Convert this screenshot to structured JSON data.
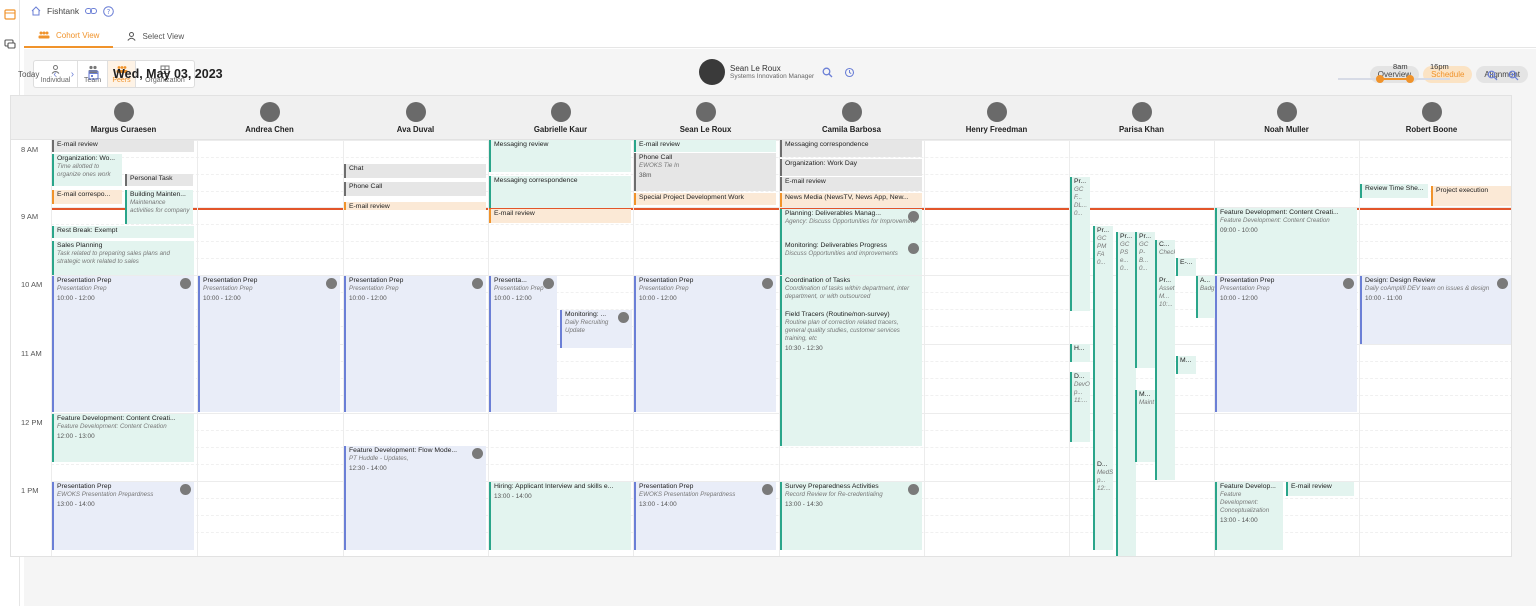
{
  "topbar": {
    "app_name": "Fishtank"
  },
  "tabs": [
    {
      "label": "Cohort View"
    },
    {
      "label": "Select View"
    }
  ],
  "levels": [
    {
      "label": "Individual"
    },
    {
      "label": "Team"
    },
    {
      "label": "Peers"
    },
    {
      "label": "Organization"
    }
  ],
  "current_user": {
    "name": "Sean Le Roux",
    "role": "Systems Innovation Manager"
  },
  "modes": [
    {
      "label": "Overview"
    },
    {
      "label": "Schedule"
    },
    {
      "label": "Alignment"
    }
  ],
  "date_nav": {
    "today": "Today",
    "date": "Wed, May 03, 2023"
  },
  "range": {
    "start_label": "8am",
    "end_label": "16pm",
    "start_fraction": 0.375,
    "end_fraction": 0.64
  },
  "colors": {
    "accent": "#f0932b",
    "now_line": "#e2552a",
    "teal": "#2aa58a",
    "blue": "#6b7fd6"
  },
  "columns": [
    {
      "name": "Margus Curaesen"
    },
    {
      "name": "Andrea Chen"
    },
    {
      "name": "Ava Duval"
    },
    {
      "name": "Gabrielle Kaur"
    },
    {
      "name": "Sean Le Roux"
    },
    {
      "name": "Camila Barbosa"
    },
    {
      "name": "Henry Freedman"
    },
    {
      "name": "Parisa Khan"
    },
    {
      "name": "Noah Muller"
    },
    {
      "name": "Robert Boone"
    }
  ],
  "time_labels": [
    "8 AM",
    "9 AM",
    "10 AM",
    "11 AM",
    "12 PM",
    "1 PM"
  ],
  "events": {
    "m1": {
      "title": "E-mail review"
    },
    "m2": {
      "title": "Organization: Wo...",
      "desc": "Time allotted to organize ones work"
    },
    "m3": {
      "title": "Personal Task"
    },
    "m4": {
      "title": "E-mail correspo..."
    },
    "m5": {
      "title": "Building Mainten...",
      "desc": "Maintenance activities for company"
    },
    "m6": {
      "title": "Rest Break: Exempt"
    },
    "m7": {
      "title": "Sales Planning",
      "desc": "Task related to preparing sales plans and strategic work related to sales"
    },
    "m8": {
      "title": "Presentation Prep",
      "desc": "Presentation Prep",
      "time": "10:00 - 12:00"
    },
    "m9": {
      "title": "Feature Development: Content Creati...",
      "desc": "Feature Development: Content Creation",
      "time": "12:00 - 13:00"
    },
    "m10": {
      "title": "Presentation Prep",
      "desc": "EWOKS Presentation Prepardness",
      "time": "13:00 - 14:00"
    },
    "a1": {
      "title": "Presentation Prep",
      "desc": "Presentation Prep",
      "time": "10:00 - 12:00"
    },
    "v1": {
      "title": "Chat"
    },
    "v2": {
      "title": "Phone Call"
    },
    "v3": {
      "title": "E-mail review"
    },
    "v4": {
      "title": "Presentation Prep",
      "desc": "Presentation Prep",
      "time": "10:00 - 12:00"
    },
    "v5": {
      "title": "Feature Development: Flow Mode...",
      "desc": "PT Huddle - Updates,",
      "time": "12:30 - 14:00"
    },
    "g1": {
      "title": "Messaging review"
    },
    "g2": {
      "title": "Messaging correspondence"
    },
    "g3": {
      "title": "E-mail review"
    },
    "g4": {
      "title": "Presenta...",
      "desc": "Presentation Prep",
      "time": "10:00 - 12:00"
    },
    "g5": {
      "title": "Monitoring: ...",
      "desc": "Daily Recruiting Update"
    },
    "g6": {
      "title": "Hiring: Applicant Interview and skills e...",
      "time": "13:00 - 14:00"
    },
    "s1": {
      "title": "E-mail review"
    },
    "s2": {
      "title": "Phone Call",
      "desc": "EWOKS Tie In",
      "time": "38m"
    },
    "s3": {
      "title": "Special Project Development Work"
    },
    "s4": {
      "title": "Presentation Prep",
      "desc": "Presentation Prep",
      "time": "10:00 - 12:00"
    },
    "s5": {
      "title": "Presentation Prep",
      "desc": "EWOKS Presentation Prepardness",
      "time": "13:00 - 14:00"
    },
    "c1": {
      "title": "Messaging correspondence"
    },
    "c2": {
      "title": "Organization: Work Day"
    },
    "c3": {
      "title": "E-mail review"
    },
    "c4": {
      "title": "News Media (NewsTV, News App, New..."
    },
    "c5": {
      "title": "Planning: Deliverables Manag...",
      "desc": "Agency: Discuss Opportunities for Improvement"
    },
    "c6": {
      "title": "Monitoring: Deliverables Progress",
      "desc": "Discuss Opportunities and improvements"
    },
    "c7": {
      "title": "Coordination of Tasks",
      "desc": "Coordination of tasks within department, inter department, or with outsourced"
    },
    "c8": {
      "title": "Field Tracers (Routine/non-survey)",
      "desc": "Routine plan of correction related tracers, general quality studies, customer services training, etc",
      "time": "10:30 - 12:30"
    },
    "c9": {
      "title": "Survey Preparedness Activities",
      "desc": "Record Review for Re-credentialing",
      "time": "13:00 - 14:30"
    },
    "p1": {
      "title": "Pr...",
      "desc": "GC F... DL... 0..."
    },
    "p2": {
      "title": "Pr...",
      "desc": "GC PM FA 0..."
    },
    "p3": {
      "title": "Pr...",
      "desc": "GC PS e... 0..."
    },
    "p4": {
      "title": "Pr...",
      "desc": "GC P- B... 0..."
    },
    "p5": {
      "title": "C...",
      "desc": "Check..."
    },
    "p6": {
      "title": "E-..."
    },
    "p7": {
      "title": "Pr...",
      "desc": "Asset M... 10:..."
    },
    "p8": {
      "title": "A...",
      "desc": "Badg"
    },
    "p9": {
      "title": "H..."
    },
    "p10": {
      "title": "M..."
    },
    "p11": {
      "title": "D...",
      "desc": "DevO p... 11:..."
    },
    "p12": {
      "title": "M...",
      "desc": "Maint"
    },
    "p13": {
      "title": "D...",
      "desc": "MedS p... 12:..."
    },
    "n1": {
      "title": "Feature Development: Content Creati...",
      "desc": "Feature Development: Content Creation",
      "time": "09:00 - 10:00"
    },
    "n2": {
      "title": "Presentation Prep",
      "desc": "Presentation Prep",
      "time": "10:00 - 12:00"
    },
    "n3": {
      "title": "Feature Develop...",
      "desc": "Feature Development: Conceptualization",
      "time": "13:00 - 14:00"
    },
    "n4": {
      "title": "E-mail review"
    },
    "r1": {
      "title": "Review Time She..."
    },
    "r2": {
      "title": "Project execution"
    },
    "r3": {
      "title": "Design: Design Review",
      "desc": "Daily coAmplifi DEV team on issues & design",
      "time": "10:00 - 11:00"
    }
  }
}
